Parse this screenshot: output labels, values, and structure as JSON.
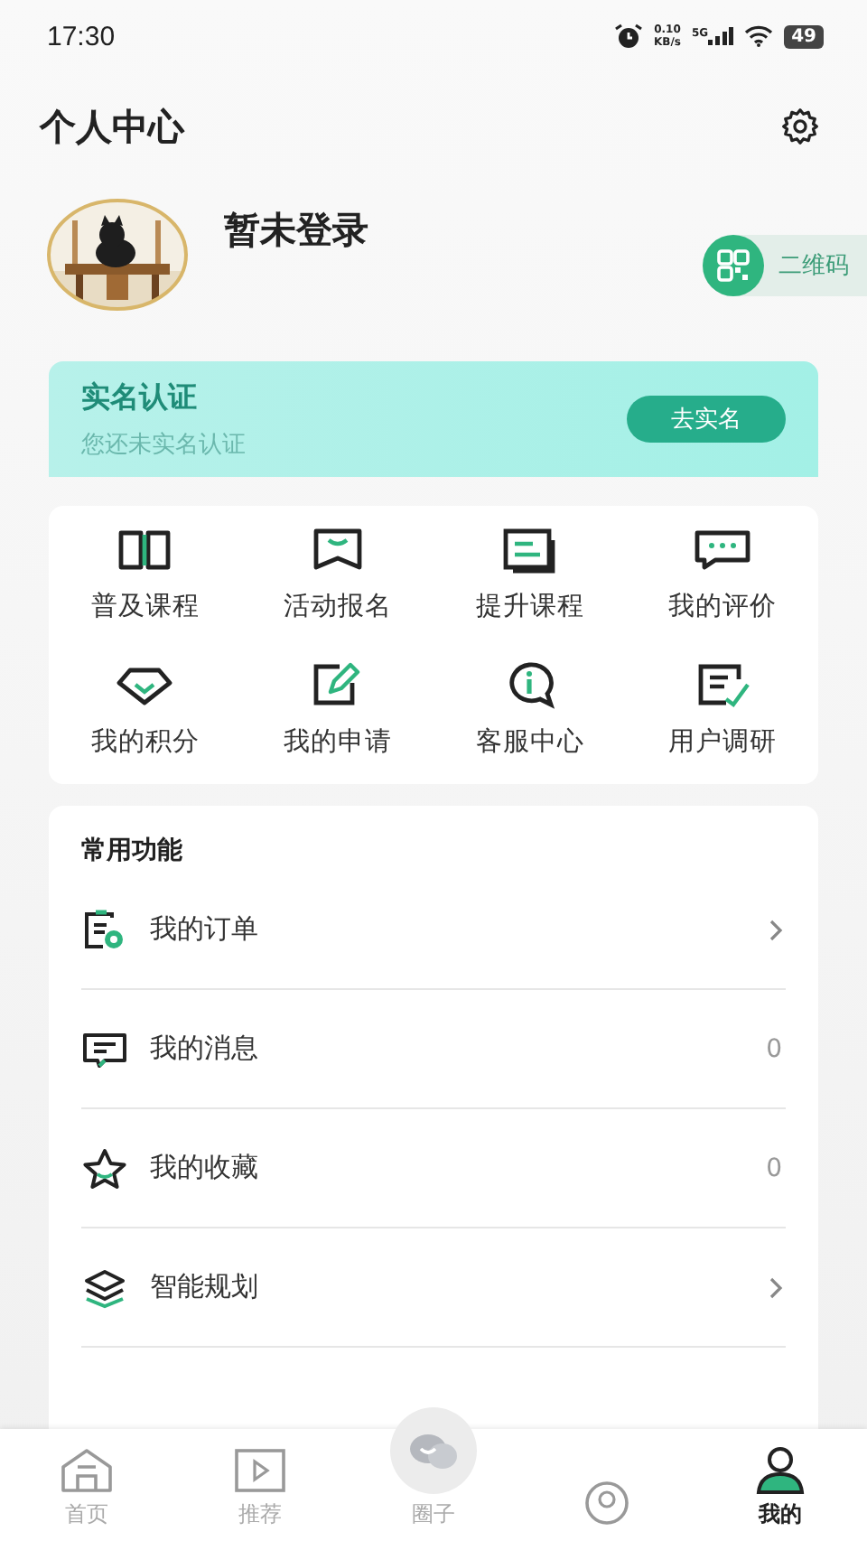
{
  "status_bar": {
    "time": "17:30",
    "speed_value": "0.10",
    "speed_unit": "KB/s",
    "network": "5G",
    "battery": "49"
  },
  "header": {
    "title": "个人中心"
  },
  "profile": {
    "name": "暂未登录",
    "qr_label": "二维码"
  },
  "verify_banner": {
    "title": "实名认证",
    "subtitle": "您还未实名认证",
    "button": "去实名"
  },
  "shortcuts": [
    {
      "label": "普及课程"
    },
    {
      "label": "活动报名"
    },
    {
      "label": "提升课程"
    },
    {
      "label": "我的评价"
    },
    {
      "label": "我的积分"
    },
    {
      "label": "我的申请"
    },
    {
      "label": "客服中心"
    },
    {
      "label": "用户调研"
    }
  ],
  "common": {
    "title": "常用功能",
    "items": [
      {
        "label": "我的订单",
        "kind": "arrow"
      },
      {
        "label": "我的消息",
        "kind": "count",
        "count": "0"
      },
      {
        "label": "我的收藏",
        "kind": "count",
        "count": "0"
      },
      {
        "label": "智能规划",
        "kind": "arrow"
      }
    ]
  },
  "tab_bar": [
    {
      "label": "首页",
      "selected": false
    },
    {
      "label": "推荐",
      "selected": false
    },
    {
      "label": "圈子",
      "selected": false
    },
    {
      "selected": false
    },
    {
      "label": "我的",
      "selected": true
    }
  ]
}
